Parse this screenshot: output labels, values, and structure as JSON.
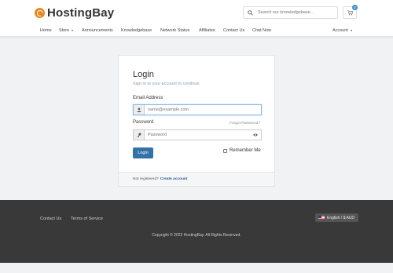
{
  "brand": {
    "name": "HostingBay",
    "color": "#e8881c"
  },
  "search": {
    "placeholder": "Search our knowledgebase..."
  },
  "cart": {
    "count": "0"
  },
  "nav": {
    "home": "Home",
    "store": "Store",
    "announcements": "Announcements",
    "knowledgebase": "Knowledgebase",
    "network_status": "Network Status",
    "affiliates": "Affiliates",
    "contact": "Contact Us",
    "chat": "Chat Now",
    "account": "Account"
  },
  "login": {
    "title": "Login",
    "subtitle": "Sign in to your account to continue.",
    "email_label": "Email Address",
    "email_placeholder": "name@example.com",
    "password_label": "Password",
    "forgot": "Forgot Password?",
    "password_placeholder": "Password",
    "button": "Login",
    "remember": "Remember Me",
    "not_registered": "Not registered?",
    "create_account": "Create account"
  },
  "footer": {
    "contact": "Contact Us",
    "terms": "Terms of Service",
    "language": "English / $ AUD",
    "copyright": "Copyright © 2022 HostingBay. All Rights Reserved."
  },
  "colors": {
    "primary_button": "#3372a8",
    "footer_bg": "#393939",
    "accent": "#3c8dcb"
  }
}
